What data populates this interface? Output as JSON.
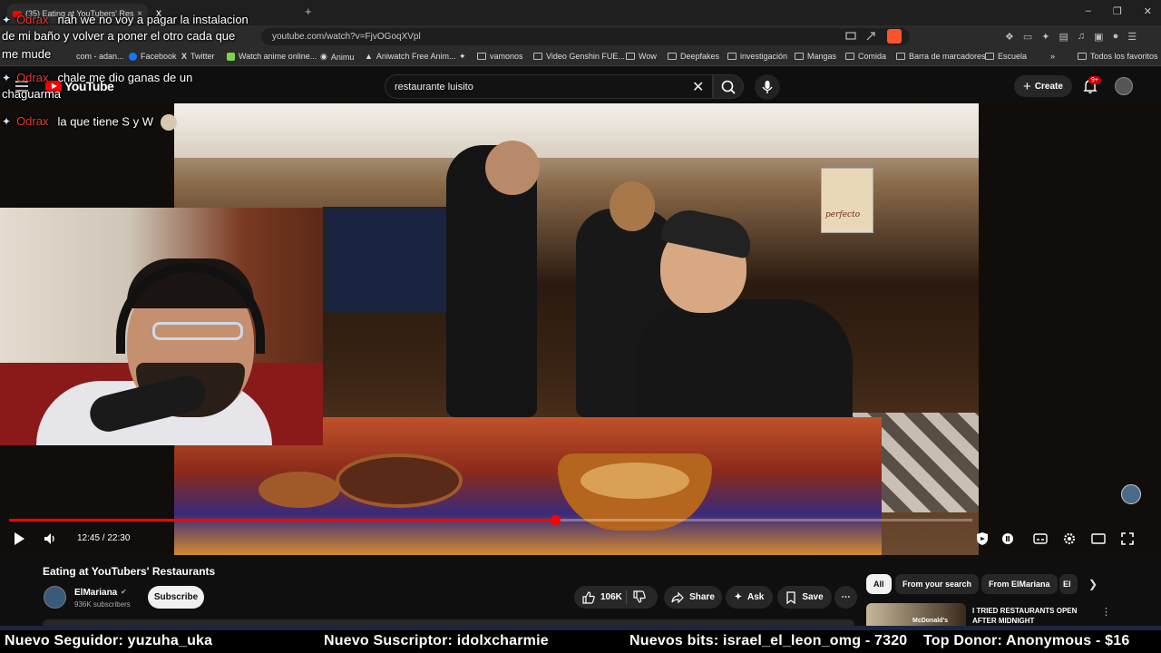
{
  "browser": {
    "tabs": [
      {
        "title": "(35) Eating at YouTubers' Res",
        "close": "×"
      },
      {
        "title": "X",
        "close": ""
      }
    ],
    "new_tab": "+",
    "address": "youtube.com/watch?v=FjvOGoqXVpl",
    "bookmarks": [
      {
        "label": "Facebook"
      },
      {
        "label": "Twitter"
      },
      {
        "label": "Watch anime online..."
      },
      {
        "label": "Animu"
      },
      {
        "label": "Aniwatch Free Anim..."
      },
      {
        "label": "vamonos"
      },
      {
        "label": "Video Genshin FUE..."
      },
      {
        "label": "Wow"
      },
      {
        "label": "Deepfakes"
      },
      {
        "label": "investigación"
      },
      {
        "label": "Mangas"
      },
      {
        "label": "Comida"
      },
      {
        "label": "Barra de marcadores"
      },
      {
        "label": "Escuela"
      }
    ],
    "bookmark_partial": "com - adan...",
    "bookmarks_overflow": "»",
    "all_favorites": "Todos los favoritos"
  },
  "youtube": {
    "logo_text": "YouTube",
    "search_value": "restaurante luisito",
    "create_label": "Create",
    "notif_count": "9+"
  },
  "chat": [
    {
      "user": "Odrax",
      "message": "nah we no voy a pagar la instalacion"
    },
    {
      "user": "",
      "message": "de mi baño y volver a poner el otro cada que"
    },
    {
      "user": "",
      "message": "me mude"
    },
    {
      "user": "Odrax",
      "message": "chale me dio ganas de un"
    },
    {
      "user": "",
      "message": "chaguarma"
    },
    {
      "user": "Odrax",
      "message": "la que tiene S y W"
    }
  ],
  "video": {
    "sign_text": "perfecto",
    "current_time": "12:45 / 22:30",
    "progress_fraction": 0.567,
    "title": "Eating at YouTubers' Restaurants",
    "channel": "ElMariana",
    "subscribers": "936K subscribers",
    "subscribe_label": "Subscribe",
    "likes": "106K",
    "share_label": "Share",
    "ask_label": "Ask",
    "save_label": "Save"
  },
  "recommendations": {
    "chips": [
      "All",
      "From your search",
      "From ElMariana",
      "El"
    ],
    "first_title": "I TRIED RESTAURANTS OPEN AFTER MIDNIGHT",
    "first_thumb_label": "McDonald's"
  },
  "ticker": [
    "Nuevo Seguidor: yuzuha_uka",
    "Nuevo Suscriptor: idolxcharmie",
    "Nuevos bits: israel_el_leon_omg - 7320",
    "Top Donor: Anonymous - $16"
  ],
  "colors": {
    "yt_red": "#ff0000",
    "chat_user": "#e53535",
    "background": "#0f0f0f"
  }
}
